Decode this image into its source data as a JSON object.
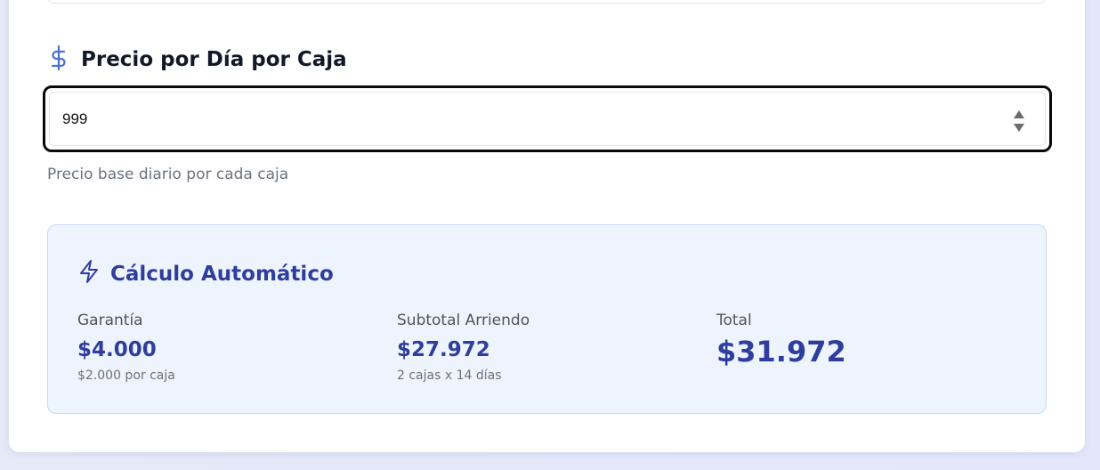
{
  "price_field": {
    "label": "Precio por Día por Caja",
    "icon": "dollar-icon",
    "value": "999",
    "hint": "Precio base diario por cada caja"
  },
  "calculation": {
    "title": "Cálculo Automático",
    "icon": "lightning-icon",
    "guarantee": {
      "label": "Garantía",
      "value": "$4.000",
      "detail": "$2.000 por caja"
    },
    "subtotal": {
      "label": "Subtotal Arriendo",
      "value": "$27.972",
      "detail": "2 cajas x 14 días"
    },
    "total": {
      "label": "Total",
      "value": "$31.972"
    }
  },
  "colors": {
    "accent": "#2f3e9e",
    "icon_blue": "#4a6fd8",
    "panel_bg": "#eef4fd",
    "panel_border": "#c7dbf5"
  }
}
